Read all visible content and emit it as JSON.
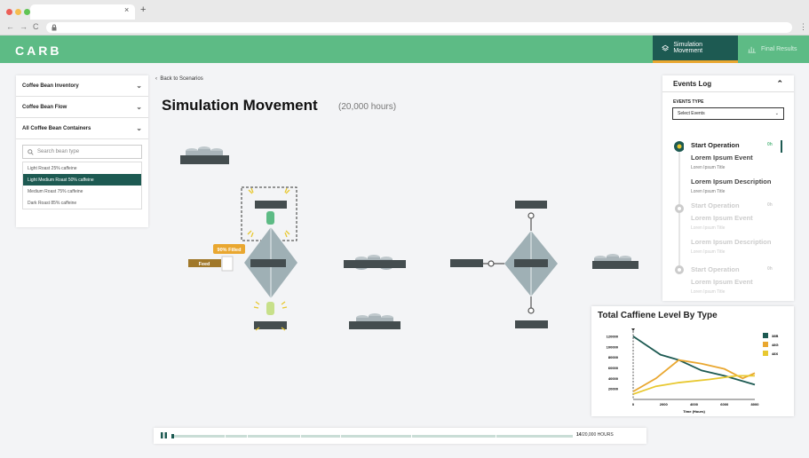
{
  "browser": {
    "tab_close": "×",
    "tab_new": "+",
    "nav": [
      "←",
      "→",
      "C"
    ],
    "menu": "⋮"
  },
  "header": {
    "logo": "CARB",
    "nav": [
      {
        "label": "Simulation Movement",
        "icon": "layers-icon"
      },
      {
        "label": "Final Results",
        "icon": "bar-chart-icon"
      }
    ]
  },
  "sidebar": {
    "accordions": [
      "Coffee Bean Inventory",
      "Coffee Bean Flow",
      "All Coffee Bean Containers"
    ],
    "search_placeholder": "Search bean type",
    "items": [
      "Light Roast 25% caffeine",
      "Light Medium Roast 50% caffeine",
      "Medium Roast 75% caffeine",
      "Dark Roast 85% caffeine"
    ],
    "selected_index": 1
  },
  "main": {
    "back": "Back to Scenarios",
    "title": "Simulation Movement",
    "subtitle": "(20,000 hours)"
  },
  "flow": {
    "badge": "90% Filled",
    "feed": "Feed"
  },
  "events": {
    "title": "Events Log",
    "type_label": "EVENTS TYPE",
    "select_value": "Select Events",
    "items": [
      {
        "op": "Start Operation",
        "time": "0h",
        "event": "Lorem Ipsum Event",
        "title": "Loren Ipsum Title",
        "desc": "Lorem Ipsum Description",
        "desc_title": "Loren Ipsum Title"
      },
      {
        "op": "Start Operation",
        "time": "0h",
        "event": "Lorem Ipsum Event",
        "title": "Loren Ipsum Title",
        "desc": "Lorem Ipsum Description",
        "desc_title": "Loren Ipsum Title"
      },
      {
        "op": "Start Operation",
        "time": "0h",
        "event": "Lorem Ipsum Event",
        "title": "Loren Ipsum Title"
      }
    ]
  },
  "chart_data": {
    "type": "line",
    "title": "Total Caffiene Level By Type",
    "xlabel": "Time (Hours)",
    "ylabel": "",
    "xlim": [
      0,
      8000
    ],
    "ylim": [
      0,
      130000
    ],
    "xticks": [
      0,
      2000,
      4000,
      6000,
      8000
    ],
    "yticks": [
      20000,
      40000,
      60000,
      80000,
      100000,
      120000
    ],
    "legend": "right",
    "series": [
      {
        "name": "38B",
        "color": "#1d5a52",
        "x": [
          0,
          1800,
          3000,
          4500,
          6000,
          8000
        ],
        "y": [
          120000,
          85000,
          75000,
          55000,
          45000,
          28000
        ]
      },
      {
        "name": "48G",
        "color": "#e9a730",
        "x": [
          0,
          1500,
          3000,
          4500,
          6000,
          7200,
          8000
        ],
        "y": [
          15000,
          40000,
          75000,
          68000,
          58000,
          40000,
          50000
        ]
      },
      {
        "name": "48X",
        "color": "#e8c830",
        "x": [
          0,
          1500,
          3000,
          5000,
          6800,
          8000
        ],
        "y": [
          10000,
          25000,
          32000,
          38000,
          45000,
          45000
        ]
      }
    ]
  },
  "player": {
    "current": "14",
    "total": "/20,000 HOURS"
  }
}
